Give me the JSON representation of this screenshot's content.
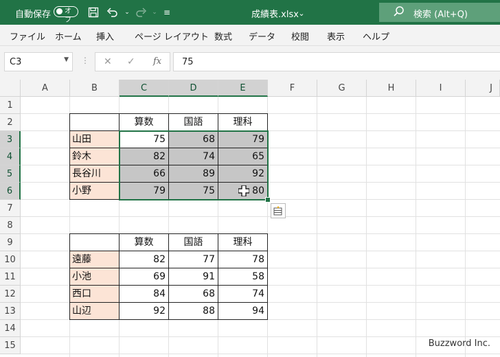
{
  "titlebar": {
    "autosave_label": "自動保存",
    "autosave_state": "オフ",
    "filename": "成績表.xlsx",
    "search_placeholder": "検索 (Alt+Q)"
  },
  "menu": [
    "ファイル",
    "ホーム",
    "挿入",
    "ページ レイアウト",
    "数式",
    "データ",
    "校閲",
    "表示",
    "ヘルプ"
  ],
  "formula_bar": {
    "name_box": "C3",
    "formula_value": "75",
    "fx": "fx"
  },
  "columns": [
    "A",
    "B",
    "C",
    "D",
    "E",
    "F",
    "G",
    "H",
    "I",
    "J"
  ],
  "rows": [
    "1",
    "2",
    "3",
    "4",
    "5",
    "6",
    "7",
    "8",
    "9",
    "10",
    "11",
    "12",
    "13",
    "14",
    "15"
  ],
  "table1": {
    "headers": [
      "算数",
      "国語",
      "理科"
    ],
    "rows": [
      {
        "name": "山田",
        "values": [
          "75",
          "68",
          "79"
        ]
      },
      {
        "name": "鈴木",
        "values": [
          "82",
          "74",
          "65"
        ]
      },
      {
        "name": "長谷川",
        "values": [
          "66",
          "89",
          "92"
        ]
      },
      {
        "name": "小野",
        "values": [
          "79",
          "75",
          "80"
        ]
      }
    ]
  },
  "table2": {
    "headers": [
      "算数",
      "国語",
      "理科"
    ],
    "rows": [
      {
        "name": "遠藤",
        "values": [
          "82",
          "77",
          "78"
        ]
      },
      {
        "name": "小池",
        "values": [
          "69",
          "91",
          "58"
        ]
      },
      {
        "name": "西口",
        "values": [
          "84",
          "68",
          "74"
        ]
      },
      {
        "name": "山辺",
        "values": [
          "92",
          "88",
          "94"
        ]
      }
    ]
  },
  "watermark": "Buzzword Inc.",
  "colors": {
    "excel_green": "#217346",
    "name_fill": "#fce4d6",
    "selection_fill": "#c6c6c6"
  }
}
